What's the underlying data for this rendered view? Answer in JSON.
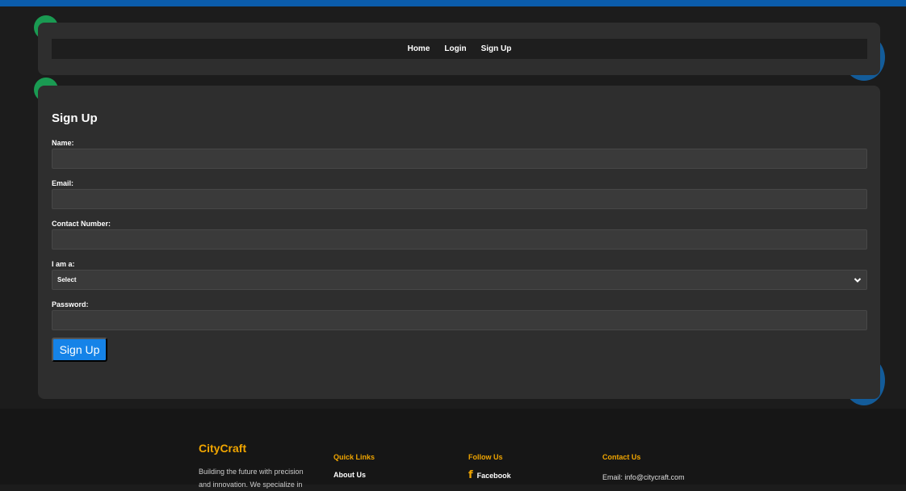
{
  "nav": {
    "items": [
      {
        "label": "Home"
      },
      {
        "label": "Login"
      },
      {
        "label": "Sign Up"
      }
    ]
  },
  "form": {
    "title": "Sign Up",
    "fields": [
      {
        "label": "Name:",
        "value": "",
        "placeholder": ""
      },
      {
        "label": "Email:",
        "value": "",
        "placeholder": ""
      },
      {
        "label": "Contact Number:",
        "value": "",
        "placeholder": ""
      },
      {
        "label": "I am a:",
        "selected": "Select"
      },
      {
        "label": "Password:",
        "value": "",
        "placeholder": ""
      }
    ],
    "submit_label": "Sign Up"
  },
  "footer": {
    "brand": "CityCraft",
    "about": "Building the future with precision and innovation. We specialize in",
    "quick_links": {
      "heading": "Quick Links",
      "items": [
        {
          "label": "About Us"
        }
      ]
    },
    "follow": {
      "heading": "Follow Us",
      "items": [
        {
          "label": "Facebook",
          "icon": "facebook-icon"
        }
      ]
    },
    "contact": {
      "heading": "Contact Us",
      "email": "Email: info@citycraft.com"
    }
  },
  "colors": {
    "accent": "#1583e8",
    "brand": "#f0a500",
    "card": "#2e2e2e",
    "background": "#1c1c1c"
  }
}
